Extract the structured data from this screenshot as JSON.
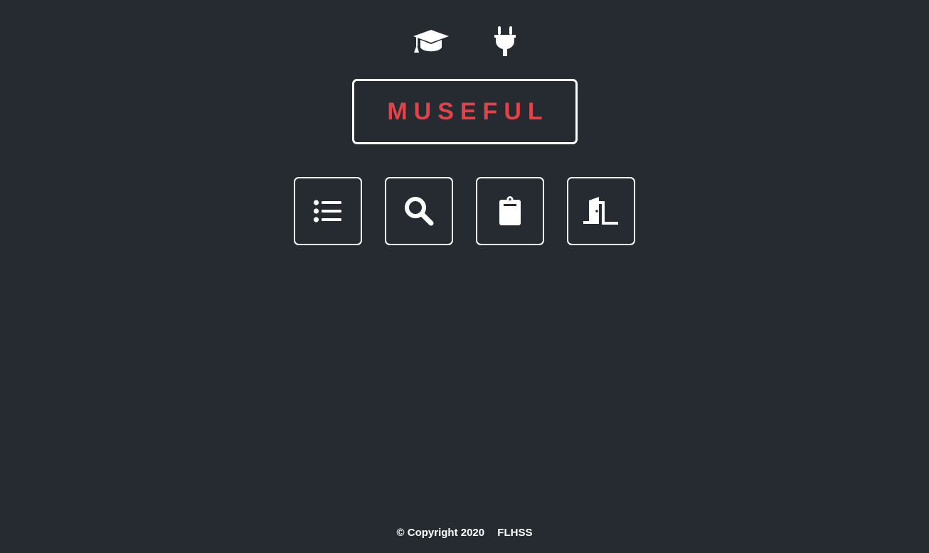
{
  "header": {
    "icons": [
      {
        "name": "graduation-cap-icon"
      },
      {
        "name": "plug-icon"
      }
    ]
  },
  "brand": {
    "title": "MUSEFUL",
    "color": "#e0434a"
  },
  "nav": {
    "buttons": [
      {
        "icon": "list-icon"
      },
      {
        "icon": "search-icon"
      },
      {
        "icon": "clipboard-icon"
      },
      {
        "icon": "door-exit-icon"
      }
    ]
  },
  "footer": {
    "copyright": "© Copyright 2020",
    "org": "FLHSS"
  },
  "colors": {
    "background": "#262b32",
    "foreground": "#ffffff",
    "accent": "#e0434a"
  }
}
